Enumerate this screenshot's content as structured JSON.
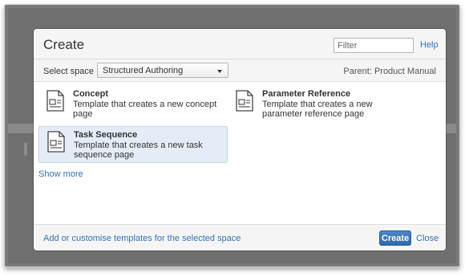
{
  "dialog": {
    "title": "Create",
    "filter_placeholder": "Filter",
    "help_label": "Help"
  },
  "space": {
    "label": "Select space",
    "selected": "Structured Authoring",
    "parent_text": "Parent: Product Manual"
  },
  "templates": [
    {
      "name": "Concept",
      "description": "Template that creates a new concept page",
      "selected": false,
      "icon": "document-icon"
    },
    {
      "name": "Parameter Reference",
      "description": "Template that creates a new parameter reference page",
      "selected": false,
      "icon": "document-icon"
    },
    {
      "name": "Task Sequence",
      "description": "Template that creates a new task sequence page",
      "selected": true,
      "icon": "document-icon"
    }
  ],
  "show_more_label": "Show more",
  "footer": {
    "customise_label": "Add or customise templates for the selected space",
    "create_label": "Create",
    "close_label": "Close"
  },
  "colors": {
    "link": "#3572b0",
    "selected_bg": "#e4edf7",
    "primary_button": "#3b78bd"
  }
}
